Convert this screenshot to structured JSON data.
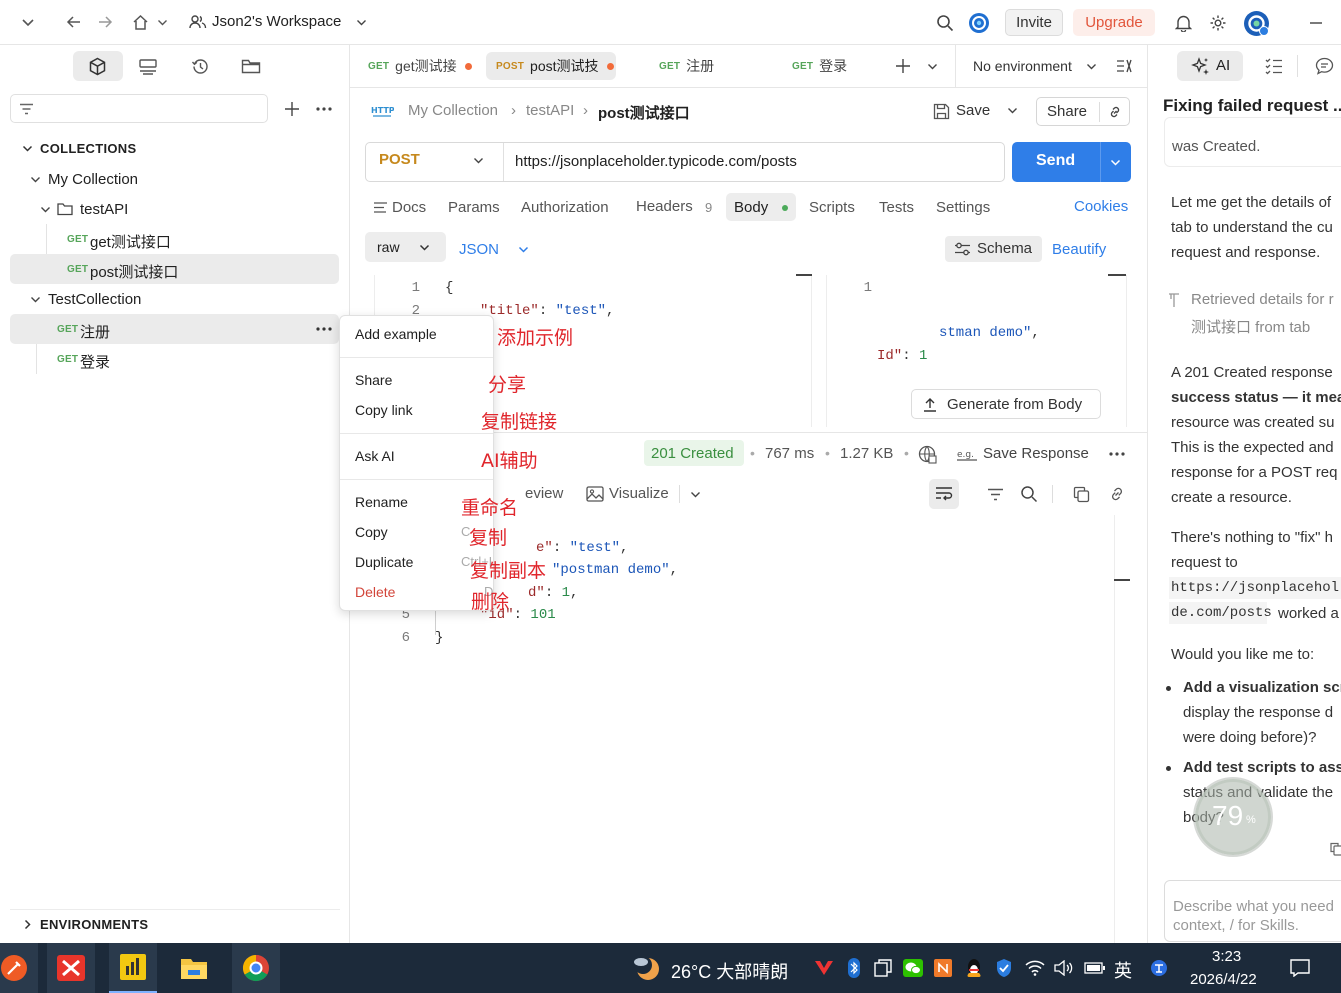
{
  "topbar": {
    "workspace": "Json2's Workspace",
    "invite": "Invite",
    "upgrade": "Upgrade"
  },
  "sidebar": {
    "section_collections": "COLLECTIONS",
    "section_environments": "ENVIRONMENTS",
    "tree": [
      {
        "label": "My Collection"
      },
      {
        "label": "testAPI"
      },
      {
        "method": "GET",
        "label": "get测试接口"
      },
      {
        "method": "GET",
        "label": "post测试接口"
      },
      {
        "label": "TestCollection"
      },
      {
        "method": "GET",
        "label": "注册"
      },
      {
        "method": "GET",
        "label": "登录"
      }
    ]
  },
  "context_menu": {
    "items": [
      "Add example",
      "Share",
      "Copy link",
      "Ask AI",
      "Rename",
      "Copy",
      "Duplicate",
      "Delete"
    ],
    "partial_shortcuts": [
      "C",
      "Ctrl+D",
      "Del"
    ],
    "annotations": [
      "添加示例",
      "分享",
      "复制链接",
      "AI辅助",
      "重命名",
      "复制",
      "复制副本",
      "删除"
    ]
  },
  "tabs": [
    {
      "method": "GET",
      "label": "get测试接"
    },
    {
      "method": "POST",
      "label": "post测试技"
    },
    {
      "method": "GET",
      "label": "注册"
    },
    {
      "method": "GET",
      "label": "登录"
    }
  ],
  "environment": "No environment",
  "breadcrumb": {
    "collection": "My Collection",
    "folder": "testAPI",
    "current": "post测试接口"
  },
  "request": {
    "method": "POST",
    "url": "https://jsonplaceholder.typicode.com/posts",
    "save": "Save",
    "share": "Share",
    "send": "Send"
  },
  "req_tabs": [
    "Docs",
    "Params",
    "Authorization",
    "Headers",
    "Body",
    "Scripts",
    "Tests",
    "Settings"
  ],
  "headers_count": "9",
  "cookies": "Cookies",
  "body": {
    "mode": "raw",
    "format": "JSON",
    "schema": "Schema",
    "beautify": "Beautify",
    "line_numbers": [
      "1",
      "2"
    ],
    "code": [
      {
        "punct": "{"
      },
      {
        "key": "\"title\"",
        "sep": ": ",
        "str": "\"test\"",
        "tail": ","
      },
      {
        "str": "stman demo\"",
        "tail": ","
      },
      {
        "pre": "Id\"",
        "sep": ": ",
        "num": "1"
      }
    ],
    "schema_line": "1",
    "generate": "Generate from Body"
  },
  "response": {
    "status": "201 Created",
    "time": "767 ms",
    "size": "1.27 KB",
    "save_response": "Save Response",
    "view_partial": "eview",
    "visualize": "Visualize",
    "line_numbers": [
      "5",
      "6"
    ],
    "code": [
      {
        "key": "e\"",
        "sep": ": ",
        "str": "\"test\"",
        "tail": ","
      },
      {
        "str": "\"postman demo\"",
        "tail": ","
      },
      {
        "key": "d\"",
        "sep": ": ",
        "num": "1",
        "tail": ","
      },
      {
        "key": "\"id\"",
        "sep": ": ",
        "num": "101"
      },
      {
        "punct": "}"
      }
    ]
  },
  "ai": {
    "tab": "AI",
    "title": "Fixing failed request ...",
    "bubble": "was Created.",
    "p1": [
      "Let me get the details of",
      "tab to understand the cu",
      "request and response."
    ],
    "retrieved": [
      "Retrieved details for r",
      "测试接口 from tab"
    ],
    "p2": [
      "A 201 Created response",
      "success status — it mea",
      "resource was created su",
      "This is the expected and",
      "response for a POST req",
      "create a resource."
    ],
    "p3": [
      "There's nothing to \"fix\" h",
      "request to"
    ],
    "code1": "https://jsonplacehol",
    "code2": "de.com/posts",
    "p3b": "worked a",
    "p4": "Would you like me to:",
    "b1": [
      "Add a visualization scr",
      "display the response d",
      "were doing before)?"
    ],
    "b2": [
      "Add test scripts to ass",
      "status and validate the",
      "body?"
    ],
    "badge": "79",
    "badge_unit": "%",
    "input_placeholder": [
      "Describe what you need",
      "context, / for Skills."
    ]
  },
  "taskbar": {
    "weather": "26°C 大部晴朗",
    "ime": "英",
    "time": "3:23",
    "date": "2026/4/22"
  },
  "colors": {
    "accent": "#2f7ee8",
    "status_green": "#3a8f3f",
    "annotation_red": "#e0262c"
  }
}
